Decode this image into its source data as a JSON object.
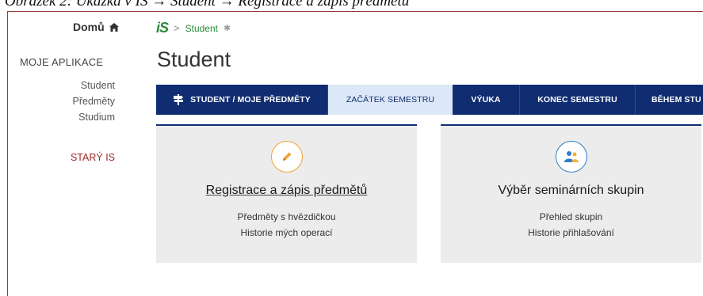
{
  "caption": "Obrázek 2: Ukázka v IS → Student → Registrace a zápis předmětu",
  "header": {
    "home_label": "Domů",
    "logo": "iS",
    "breadcrumb_separator": ">",
    "breadcrumb_current": "Student",
    "pin_glyph": "✱"
  },
  "sidebar": {
    "heading": "MOJE APLIKACE",
    "items": [
      {
        "label": "Student"
      },
      {
        "label": "Předměty"
      },
      {
        "label": "Studium"
      }
    ],
    "old_is": "STARÝ IS"
  },
  "main": {
    "title": "Student",
    "tabs": [
      {
        "label": "STUDENT / MOJE PŘEDMĚTY",
        "active": false
      },
      {
        "label": "ZAČÁTEK SEMESTRU",
        "active": true
      },
      {
        "label": "VÝUKA",
        "active": false
      },
      {
        "label": "KONEC SEMESTRU",
        "active": false
      },
      {
        "label": "BĚHEM STU",
        "active": false
      }
    ],
    "cards": [
      {
        "icon": "pencil-icon",
        "title": "Registrace a zápis předmětů",
        "links": [
          "Předměty s hvězdičkou",
          "Historie mých operací"
        ]
      },
      {
        "icon": "people-icon",
        "title": "Výběr seminárních skupin",
        "links": [
          "Přehled skupin",
          "Historie přihlašování"
        ]
      }
    ]
  },
  "colors": {
    "nav_bg": "#102d72",
    "active_tab_bg": "#dce7f7",
    "brand_green": "#2a8a3a",
    "pencil_accent": "#f0a030",
    "people_accent": "#2a7fc8",
    "old_is_red": "#a02a2a"
  }
}
